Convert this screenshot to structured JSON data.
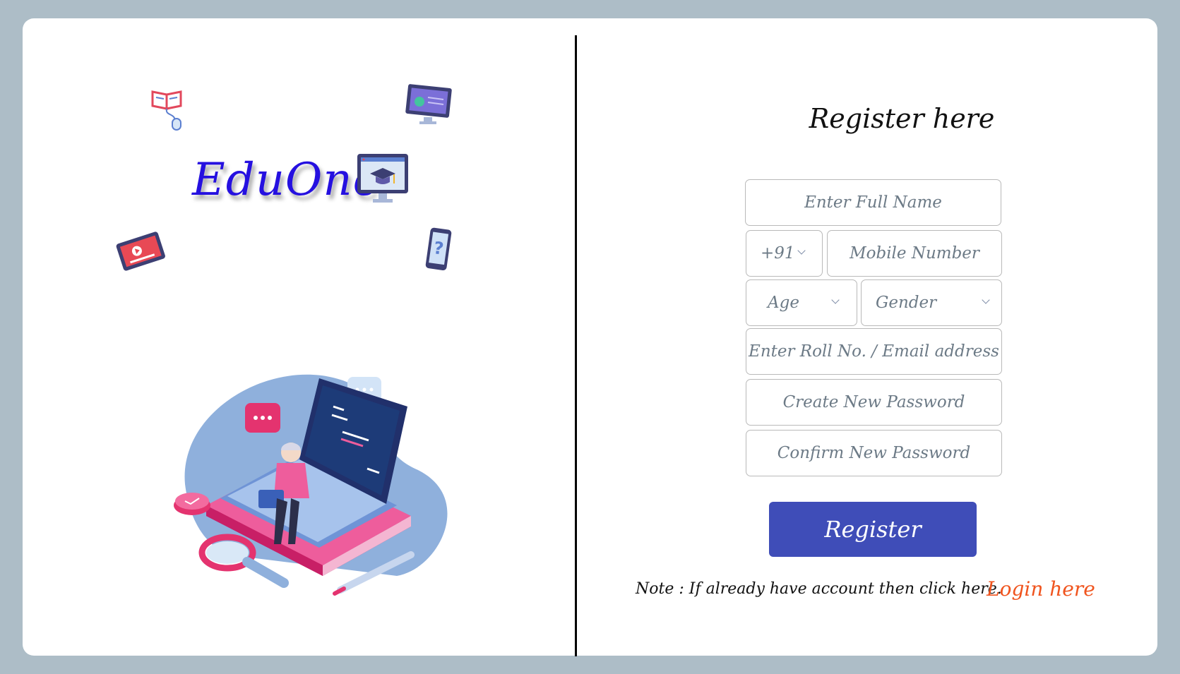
{
  "brand": {
    "name": "EduOne"
  },
  "form": {
    "title": "Register here",
    "full_name_placeholder": "Enter Full Name",
    "country_code": "+91",
    "mobile_placeholder": "Mobile Number",
    "age_placeholder": "Age",
    "gender_placeholder": "Gender",
    "roll_placeholder": "Enter Roll No. / Email address",
    "password_placeholder": "Create New Password",
    "confirm_password_placeholder": "Confirm New Password",
    "register_label": "Register"
  },
  "footer": {
    "note": "Note : If already have account then click here.",
    "login_label": "Login here"
  },
  "icons": [
    "book-mouse-icon",
    "monitor-chart-icon",
    "graduation-monitor-icon",
    "video-tablet-icon",
    "phone-question-icon",
    "chevron-down-icon"
  ],
  "colors": {
    "brand": "#2510e0",
    "button": "#3f4db8",
    "link": "#f0541e",
    "background": "#adbdc7"
  }
}
